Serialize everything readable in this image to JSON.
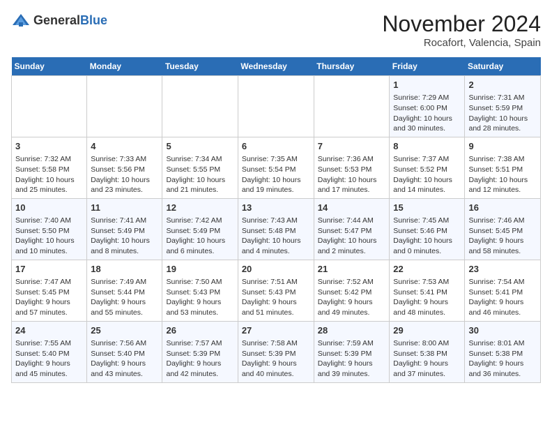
{
  "header": {
    "logo_line1": "General",
    "logo_line2": "Blue",
    "month": "November 2024",
    "location": "Rocafort, Valencia, Spain"
  },
  "weekdays": [
    "Sunday",
    "Monday",
    "Tuesday",
    "Wednesday",
    "Thursday",
    "Friday",
    "Saturday"
  ],
  "weeks": [
    [
      {
        "day": "",
        "info": ""
      },
      {
        "day": "",
        "info": ""
      },
      {
        "day": "",
        "info": ""
      },
      {
        "day": "",
        "info": ""
      },
      {
        "day": "",
        "info": ""
      },
      {
        "day": "1",
        "info": "Sunrise: 7:29 AM\nSunset: 6:00 PM\nDaylight: 10 hours and 30 minutes."
      },
      {
        "day": "2",
        "info": "Sunrise: 7:31 AM\nSunset: 5:59 PM\nDaylight: 10 hours and 28 minutes."
      }
    ],
    [
      {
        "day": "3",
        "info": "Sunrise: 7:32 AM\nSunset: 5:58 PM\nDaylight: 10 hours and 25 minutes."
      },
      {
        "day": "4",
        "info": "Sunrise: 7:33 AM\nSunset: 5:56 PM\nDaylight: 10 hours and 23 minutes."
      },
      {
        "day": "5",
        "info": "Sunrise: 7:34 AM\nSunset: 5:55 PM\nDaylight: 10 hours and 21 minutes."
      },
      {
        "day": "6",
        "info": "Sunrise: 7:35 AM\nSunset: 5:54 PM\nDaylight: 10 hours and 19 minutes."
      },
      {
        "day": "7",
        "info": "Sunrise: 7:36 AM\nSunset: 5:53 PM\nDaylight: 10 hours and 17 minutes."
      },
      {
        "day": "8",
        "info": "Sunrise: 7:37 AM\nSunset: 5:52 PM\nDaylight: 10 hours and 14 minutes."
      },
      {
        "day": "9",
        "info": "Sunrise: 7:38 AM\nSunset: 5:51 PM\nDaylight: 10 hours and 12 minutes."
      }
    ],
    [
      {
        "day": "10",
        "info": "Sunrise: 7:40 AM\nSunset: 5:50 PM\nDaylight: 10 hours and 10 minutes."
      },
      {
        "day": "11",
        "info": "Sunrise: 7:41 AM\nSunset: 5:49 PM\nDaylight: 10 hours and 8 minutes."
      },
      {
        "day": "12",
        "info": "Sunrise: 7:42 AM\nSunset: 5:49 PM\nDaylight: 10 hours and 6 minutes."
      },
      {
        "day": "13",
        "info": "Sunrise: 7:43 AM\nSunset: 5:48 PM\nDaylight: 10 hours and 4 minutes."
      },
      {
        "day": "14",
        "info": "Sunrise: 7:44 AM\nSunset: 5:47 PM\nDaylight: 10 hours and 2 minutes."
      },
      {
        "day": "15",
        "info": "Sunrise: 7:45 AM\nSunset: 5:46 PM\nDaylight: 10 hours and 0 minutes."
      },
      {
        "day": "16",
        "info": "Sunrise: 7:46 AM\nSunset: 5:45 PM\nDaylight: 9 hours and 58 minutes."
      }
    ],
    [
      {
        "day": "17",
        "info": "Sunrise: 7:47 AM\nSunset: 5:45 PM\nDaylight: 9 hours and 57 minutes."
      },
      {
        "day": "18",
        "info": "Sunrise: 7:49 AM\nSunset: 5:44 PM\nDaylight: 9 hours and 55 minutes."
      },
      {
        "day": "19",
        "info": "Sunrise: 7:50 AM\nSunset: 5:43 PM\nDaylight: 9 hours and 53 minutes."
      },
      {
        "day": "20",
        "info": "Sunrise: 7:51 AM\nSunset: 5:43 PM\nDaylight: 9 hours and 51 minutes."
      },
      {
        "day": "21",
        "info": "Sunrise: 7:52 AM\nSunset: 5:42 PM\nDaylight: 9 hours and 49 minutes."
      },
      {
        "day": "22",
        "info": "Sunrise: 7:53 AM\nSunset: 5:41 PM\nDaylight: 9 hours and 48 minutes."
      },
      {
        "day": "23",
        "info": "Sunrise: 7:54 AM\nSunset: 5:41 PM\nDaylight: 9 hours and 46 minutes."
      }
    ],
    [
      {
        "day": "24",
        "info": "Sunrise: 7:55 AM\nSunset: 5:40 PM\nDaylight: 9 hours and 45 minutes."
      },
      {
        "day": "25",
        "info": "Sunrise: 7:56 AM\nSunset: 5:40 PM\nDaylight: 9 hours and 43 minutes."
      },
      {
        "day": "26",
        "info": "Sunrise: 7:57 AM\nSunset: 5:39 PM\nDaylight: 9 hours and 42 minutes."
      },
      {
        "day": "27",
        "info": "Sunrise: 7:58 AM\nSunset: 5:39 PM\nDaylight: 9 hours and 40 minutes."
      },
      {
        "day": "28",
        "info": "Sunrise: 7:59 AM\nSunset: 5:39 PM\nDaylight: 9 hours and 39 minutes."
      },
      {
        "day": "29",
        "info": "Sunrise: 8:00 AM\nSunset: 5:38 PM\nDaylight: 9 hours and 37 minutes."
      },
      {
        "day": "30",
        "info": "Sunrise: 8:01 AM\nSunset: 5:38 PM\nDaylight: 9 hours and 36 minutes."
      }
    ]
  ]
}
